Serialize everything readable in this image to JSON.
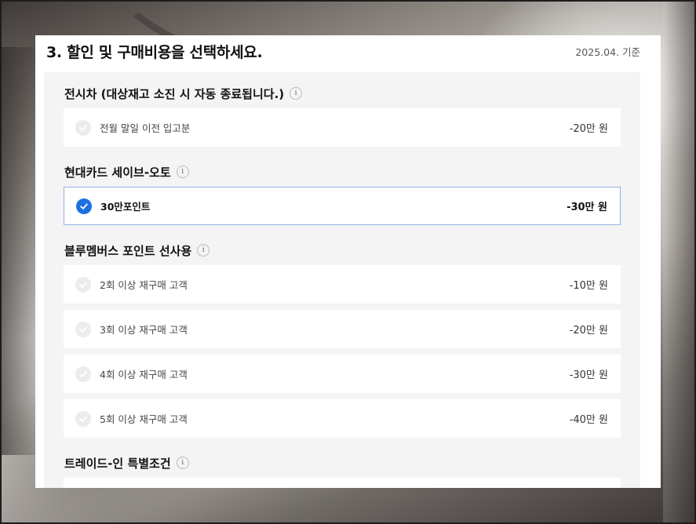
{
  "panel": {
    "title": "3. 할인 및 구매비용을 선택하세요.",
    "date": "2025.04. 기준"
  },
  "sections": [
    {
      "title": "전시차 (대상재고 소진 시 자동 종료됩니다.)",
      "info": "i",
      "options": [
        {
          "label": "전월 말일 이전 입고분",
          "price": "-20만 원",
          "selected": false
        }
      ]
    },
    {
      "title": "현대카드 세이브-오토",
      "info": "i",
      "options": [
        {
          "label": "30만포인트",
          "price": "-30만 원",
          "selected": true
        }
      ]
    },
    {
      "title": "블루멤버스 포인트 선사용",
      "info": "i",
      "options": [
        {
          "label": "2회 이상 재구매 고객",
          "price": "-10만 원",
          "selected": false
        },
        {
          "label": "3회 이상 재구매 고객",
          "price": "-20만 원",
          "selected": false
        },
        {
          "label": "4회 이상 재구매 고객",
          "price": "-30만 원",
          "selected": false
        },
        {
          "label": "5회 이상 재구매 고객",
          "price": "-40만 원",
          "selected": false
        }
      ]
    },
    {
      "title": "트레이드-인 특별조건",
      "info": "i",
      "options": []
    }
  ],
  "colors": {
    "accent": "#1e6fe0",
    "selected_border": "#8fb3e8",
    "sheet_bg": "#f4f4f4"
  }
}
